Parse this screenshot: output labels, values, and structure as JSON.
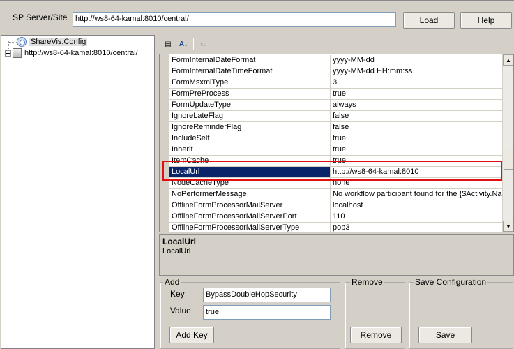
{
  "server": {
    "label": "SP Server/Site",
    "url": "http://ws8-64-kamal:8010/central/",
    "load_label": "Load",
    "help_label": "Help"
  },
  "tree": {
    "items": [
      {
        "label": "ShareVis.Config"
      },
      {
        "label": "http://ws8-64-kamal:8010/central/"
      }
    ]
  },
  "toolbar": {
    "categorized_glyph": "▤",
    "alphabetical_glyph": "A↓",
    "pages_glyph": "▭"
  },
  "grid": {
    "rows": [
      {
        "name": "FormInternalDateFormat",
        "value": "yyyy-MM-dd"
      },
      {
        "name": "FormInternalDateTimeFormat",
        "value": "yyyy-MM-dd HH:mm:ss"
      },
      {
        "name": "FormMsxmlType",
        "value": "3"
      },
      {
        "name": "FormPreProcess",
        "value": "true"
      },
      {
        "name": "FormUpdateType",
        "value": "always"
      },
      {
        "name": "IgnoreLateFlag",
        "value": "false"
      },
      {
        "name": "IgnoreReminderFlag",
        "value": "false"
      },
      {
        "name": "IncludeSelf",
        "value": "true"
      },
      {
        "name": "Inherit",
        "value": "true"
      },
      {
        "name": "ItemCache",
        "value": "true"
      },
      {
        "name": "LocalUrl",
        "value": "http://ws8-64-kamal:8010"
      },
      {
        "name": "NodeCacheType",
        "value": "none"
      },
      {
        "name": "NoPerformerMessage",
        "value": "No workflow participant found for the {$Activity.Nam"
      },
      {
        "name": "OfflineFormProcessorMailServer",
        "value": "localhost"
      },
      {
        "name": "OfflineFormProcessorMailServerPort",
        "value": "110"
      },
      {
        "name": "OfflineFormProcessorMailServerType",
        "value": "pop3"
      }
    ],
    "scroll_up_glyph": "▲",
    "scroll_down_glyph": "▼"
  },
  "description": {
    "title": "LocalUrl",
    "text": "LocalUrl"
  },
  "add": {
    "legend": "Add",
    "key_label": "Key",
    "key_value": "BypassDoubleHopSecurity",
    "value_label": "Value",
    "value_value": "true",
    "button_label": "Add Key"
  },
  "remove": {
    "legend": "Remove",
    "button_label": "Remove"
  },
  "save": {
    "legend": "Save Configuration",
    "button_label": "Save"
  },
  "colors": {
    "selection": "#0a246a",
    "highlight_box": "#e01010"
  }
}
